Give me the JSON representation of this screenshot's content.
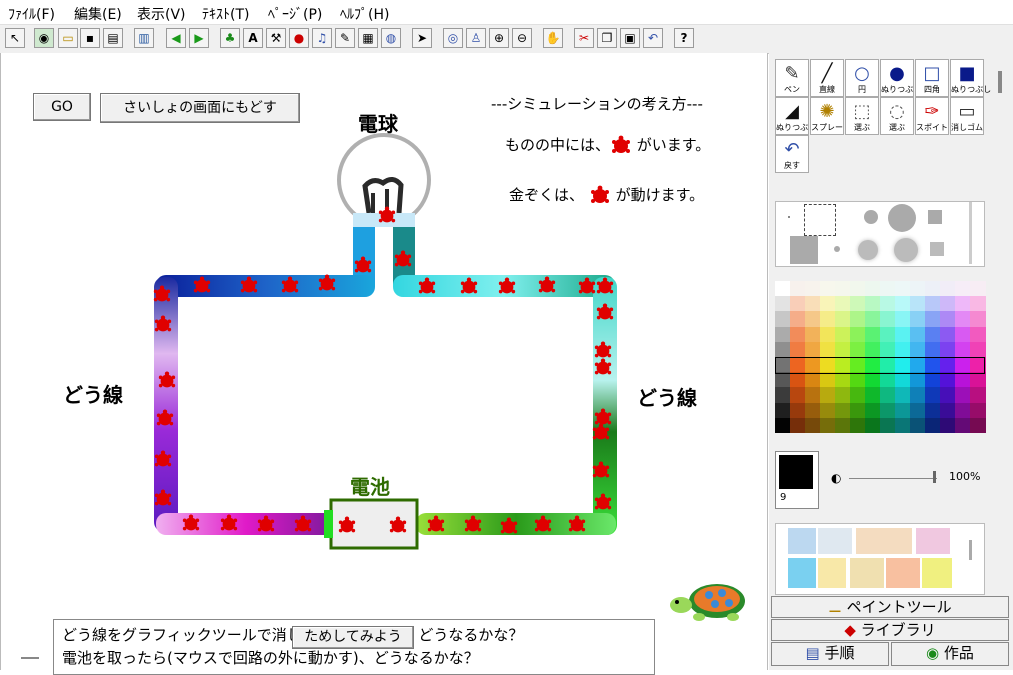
{
  "menu": [
    "ﾌｧｲﾙ(F)",
    "編集(E)",
    "表示(V)",
    "ﾃｷｽﾄ(T)",
    "ﾍﾟｰｼﾞ(P)",
    "ﾍﾙﾌﾟ(H)"
  ],
  "toolbar_icons": [
    "cursor-icon",
    "world-icon",
    "open-folder-icon",
    "save-icon",
    "print-icon",
    "page-icon",
    "back-arrow-icon",
    "forward-arrow-icon",
    "paint-icon",
    "text-A-icon",
    "tool-icon",
    "sticker-icon",
    "music-icon",
    "pen-icon",
    "film-icon",
    "sound-icon",
    "pointer-icon",
    "eye-icon",
    "stamp-icon",
    "zoom-in-icon",
    "zoom-out-icon",
    "stop-hand-icon",
    "cut-icon",
    "copy-icon",
    "paste-icon",
    "undo-icon",
    "help-icon"
  ],
  "canvas": {
    "go_button": "GO",
    "back_button": "さいしょの画面にもどす",
    "bulb_label": "電球",
    "battery_label": "電池",
    "left_wire_label": "どう線",
    "right_wire_label": "どう線",
    "sim_title": "---シミュレーションの考え方---",
    "sim_line1_a": "ものの中には、",
    "sim_line1_b": "がいます。",
    "sim_line2_a": "金ぞくは、",
    "sim_line2_b": "が動けます。",
    "instruction_1": "どう線をグラフィックツールで消したら(白でぬる)、どうなるかな？",
    "instruction_2": "電池を取ったら(マウスで回路の外に動かす)、どうなるかな？",
    "try_button": "ためしてみよう"
  },
  "paint_panel": {
    "tools_row1": [
      "ペン",
      "直線",
      "円",
      "ぬりつぶし",
      "四角",
      "ぬりつぶし"
    ],
    "tools_row2": [
      "ぬりつぶし",
      "スプレー",
      "選ぶ",
      "選ぶ",
      "スポイト",
      "消しゴム"
    ],
    "tools_row3": [
      "戻す"
    ],
    "brush_size": "9",
    "opacity": "100%",
    "tab_paint": "ペイントツール",
    "tab_library": "ライブラリ",
    "tab_steps": "手順",
    "tab_works": "作品"
  },
  "colors": {
    "accent_red": "#e00000",
    "battery_green": "#2e6b00"
  }
}
